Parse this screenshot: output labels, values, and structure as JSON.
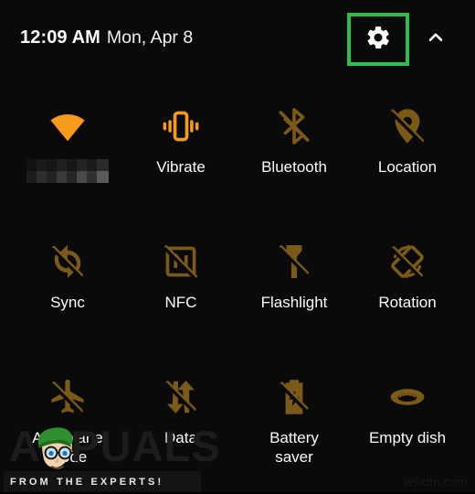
{
  "header": {
    "time": "12:09 AM",
    "date": "Mon, Apr 8",
    "settings_icon": "gear-icon",
    "settings_label": "Settings",
    "expand_icon": "chevron-up-icon",
    "expand_label": "Collapse",
    "highlight_color": "#2fbd4f"
  },
  "colors": {
    "background": "#0a0a0a",
    "tile_on": "#f89a1c",
    "tile_off": "#7a5a16",
    "label": "#fafafa",
    "highlight": "#2fbd4f"
  },
  "tiles": [
    {
      "id": "wifi",
      "label": "",
      "censored": true,
      "icon": "wifi-icon",
      "state": "on"
    },
    {
      "id": "vibrate",
      "label": "Vibrate",
      "censored": false,
      "icon": "vibrate-icon",
      "state": "on"
    },
    {
      "id": "bluetooth",
      "label": "Bluetooth",
      "censored": false,
      "icon": "bluetooth-off-icon",
      "state": "off"
    },
    {
      "id": "location",
      "label": "Location",
      "censored": false,
      "icon": "location-off-icon",
      "state": "off"
    },
    {
      "id": "sync",
      "label": "Sync",
      "censored": false,
      "icon": "sync-off-icon",
      "state": "off"
    },
    {
      "id": "nfc",
      "label": "NFC",
      "censored": false,
      "icon": "nfc-off-icon",
      "state": "off"
    },
    {
      "id": "flashlight",
      "label": "Flashlight",
      "censored": false,
      "icon": "flashlight-off-icon",
      "state": "off"
    },
    {
      "id": "rotation",
      "label": "Rotation",
      "censored": false,
      "icon": "rotation-off-icon",
      "state": "off"
    },
    {
      "id": "aeroplane-mode",
      "label": "Aeroplane\nmode",
      "censored": false,
      "icon": "airplane-off-icon",
      "state": "off"
    },
    {
      "id": "data",
      "label": "Data",
      "censored": false,
      "icon": "mobile-data-off-icon",
      "state": "off"
    },
    {
      "id": "battery-saver",
      "label": "Battery\nsaver",
      "censored": false,
      "icon": "battery-saver-off-icon",
      "state": "off"
    },
    {
      "id": "empty-dish",
      "label": "Empty dish",
      "censored": false,
      "icon": "empty-dish-icon",
      "state": "off"
    }
  ],
  "watermark": {
    "wordmark": "APPUALS",
    "tagline": "FROM THE EXPERTS!",
    "site": "wsxdn.com"
  }
}
